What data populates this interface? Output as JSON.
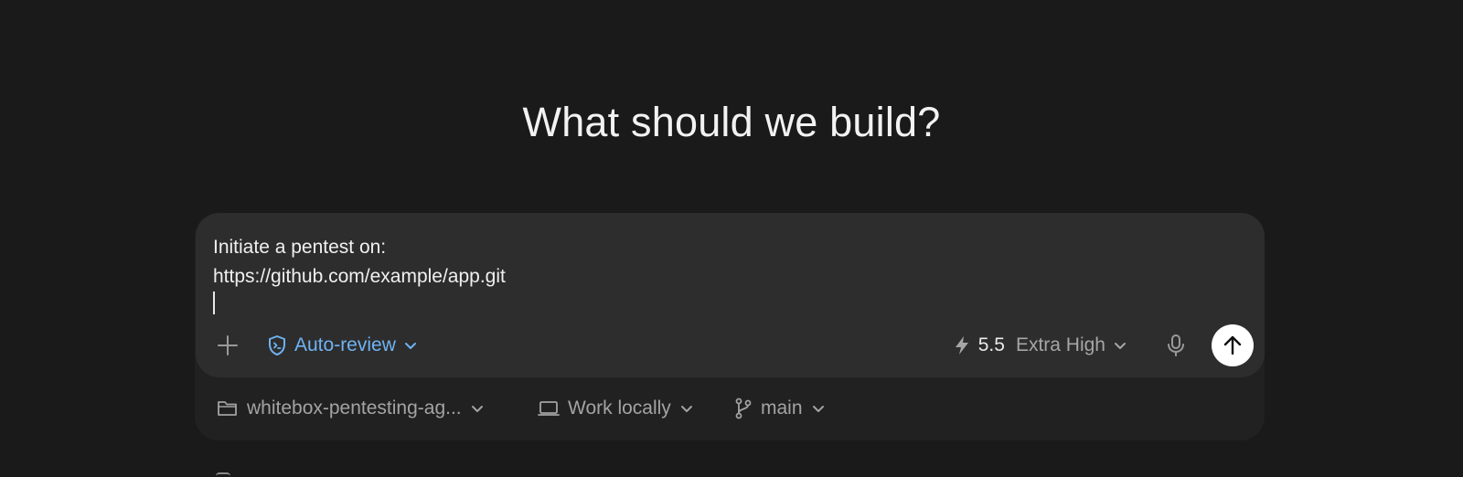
{
  "headline": "What should we build?",
  "composer": {
    "prompt_text": "Initiate a pentest on:\nhttps://github.com/example/app.git",
    "toolbar": {
      "review_label": "Auto-review",
      "model_version": "5.5",
      "model_effort": "Extra High"
    }
  },
  "footer": {
    "project_label": "whitebox-pentesting-ag...",
    "environment_label": "Work locally",
    "branch_label": "main"
  },
  "colors": {
    "background": "#1a1a1a",
    "composer": "#2d2d2d",
    "accent_blue": "#6fb3f2",
    "send_button": "#ffffff"
  }
}
